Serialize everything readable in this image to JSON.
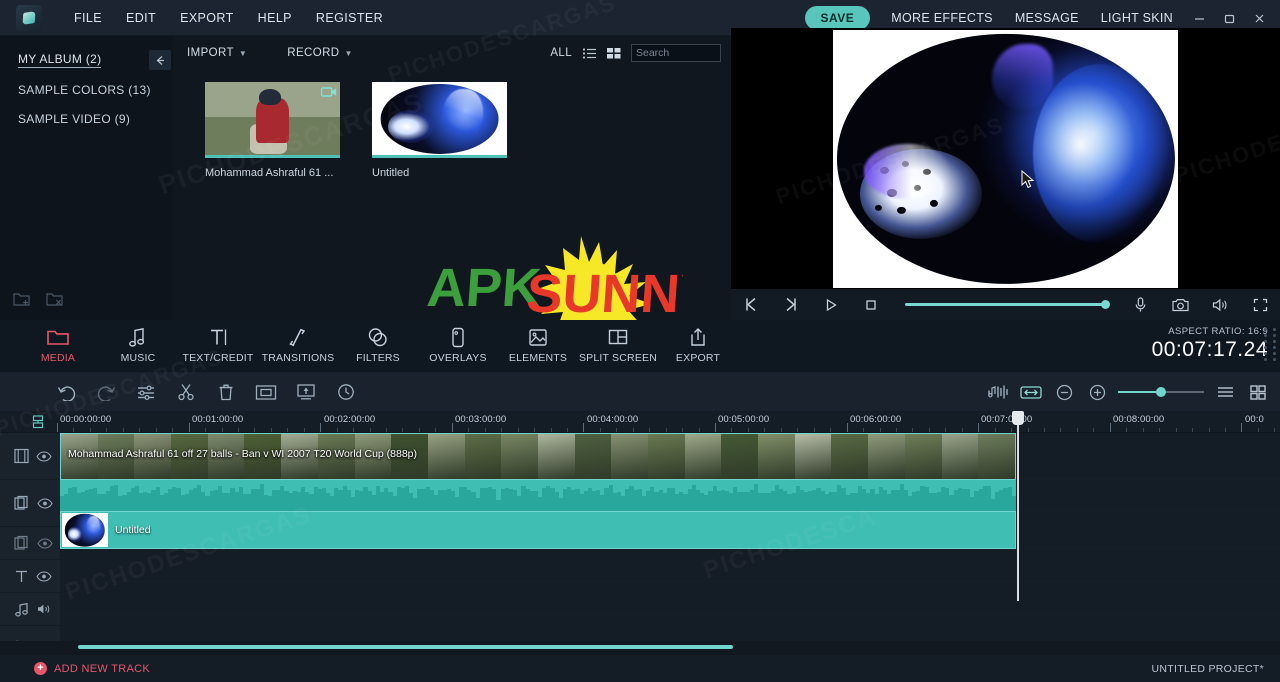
{
  "app": {
    "brand_icon": "filmora-logo-icon",
    "menu": [
      "FILE",
      "EDIT",
      "EXPORT",
      "HELP",
      "REGISTER"
    ],
    "save_label": "SAVE",
    "right_links": [
      "MORE EFFECTS",
      "MESSAGE",
      "LIGHT SKIN"
    ],
    "window_controls": [
      "minimize-icon",
      "restore-icon",
      "close-icon"
    ],
    "accent_teal": "#58c6bb",
    "accent_red": "#e8566a",
    "project_name": "UNTITLED PROJECT*"
  },
  "library": {
    "items": [
      {
        "label": "MY ALBUM (2)",
        "active": true
      },
      {
        "label": "SAMPLE COLORS (13)",
        "active": false
      },
      {
        "label": "SAMPLE VIDEO (9)",
        "active": false
      }
    ],
    "collapse_icon": "arrow-left-icon",
    "bottom_icons": [
      "add-folder-icon",
      "delete-folder-icon"
    ]
  },
  "media_panel": {
    "import_label": "IMPORT",
    "record_label": "RECORD",
    "all_label": "ALL",
    "list_view_icon": "list-view-icon",
    "grid_view_icon": "grid-view-icon",
    "search": {
      "placeholder": "Search",
      "value": "",
      "icon": "search-icon"
    },
    "items": [
      {
        "label": "Mohammad Ashraful 61 ...",
        "type": "video",
        "badge": "video-camera-icon"
      },
      {
        "label": "Untitled",
        "type": "image",
        "badge": ""
      }
    ],
    "watermark_logo": {
      "part1": "APK",
      "part2": "SUNNY"
    }
  },
  "preview": {
    "controls": [
      {
        "name": "prev-frame-button",
        "glyph": "K"
      },
      {
        "name": "next-frame-button",
        "glyph": "K-mirrored"
      },
      {
        "name": "play-button",
        "glyph": "play-triangle"
      },
      {
        "name": "stop-button",
        "glyph": "square"
      }
    ],
    "volume_percent": 100,
    "right_controls": [
      {
        "name": "voiceover-button",
        "glyph": "microphone-icon"
      },
      {
        "name": "snapshot-button",
        "glyph": "camera-icon"
      },
      {
        "name": "volume-button",
        "glyph": "speaker-icon"
      },
      {
        "name": "fullscreen-button",
        "glyph": "expand-icon"
      }
    ]
  },
  "function_tabs": [
    {
      "label": "MEDIA",
      "icon": "folder-icon",
      "active": true
    },
    {
      "label": "MUSIC",
      "icon": "music-note-icon",
      "active": false
    },
    {
      "label": "TEXT/CREDIT",
      "icon": "text-t-icon",
      "active": false
    },
    {
      "label": "TRANSITIONS",
      "icon": "transition-arrows-icon",
      "active": false
    },
    {
      "label": "FILTERS",
      "icon": "filters-circles-icon",
      "active": false
    },
    {
      "label": "OVERLAYS",
      "icon": "overlay-rect-icon",
      "active": false
    },
    {
      "label": "ELEMENTS",
      "icon": "image-elements-icon",
      "active": false
    },
    {
      "label": "SPLIT SCREEN",
      "icon": "split-screen-icon",
      "active": false
    },
    {
      "label": "EXPORT",
      "icon": "export-upload-icon",
      "active": false
    }
  ],
  "project_info": {
    "aspect_label": "ASPECT RATIO:",
    "aspect_value": "16:9",
    "duration": "00:07:17.24"
  },
  "timeline_toolbar": {
    "left_icons": [
      "undo-icon",
      "redo-icon",
      "settings-sliders-icon",
      "scissors-cut-icon",
      "trash-delete-icon",
      "crop-icon",
      "green-screen-icon",
      "speed-clock-icon"
    ],
    "right_icons": [
      "audio-detach-icon",
      "fit-timeline-icon",
      "zoom-out-icon",
      "zoom-in-icon"
    ],
    "zoom_value": 48,
    "view_icons": [
      "list-layout-icon",
      "grid-layout-icon"
    ]
  },
  "ruler": {
    "lock_icon": "timeline-lock-icon",
    "labels": [
      "00:00:00:00",
      "00:01:00:00",
      "00:02:00:00",
      "00:03:00:00",
      "00:04:00:00",
      "00:05:00:00",
      "00:06:00:00",
      "00:07:00:00",
      "00:08:00:00",
      "00:0"
    ],
    "playhead_time": "00:07:00:00"
  },
  "tracks": [
    {
      "name": "video-track-1",
      "icons": [
        "film-strip-icon",
        "eye-icon"
      ]
    },
    {
      "name": "pip-track-1",
      "icons": [
        "layers-icon",
        "eye-icon"
      ]
    },
    {
      "name": "pip-track-2",
      "icons": [
        "layers-icon",
        "eye-icon"
      ]
    },
    {
      "name": "text-track",
      "icons": [
        "text-t-icon",
        "eye-icon"
      ]
    },
    {
      "name": "audio-track",
      "icons": [
        "music-note-icon",
        "speaker-icon"
      ]
    }
  ],
  "clips": {
    "video_clip_title": "Mohammad Ashraful 61 off 27 balls - Ban v WI 2007 T20 World Cup (888p)",
    "pip_clip_title": "Untitled"
  },
  "bottom": {
    "add_track_label": "ADD NEW TRACK",
    "add_track_icon": "plus-circle-icon"
  },
  "watermarks": [
    "PICHODESCARGAS",
    "PICHODESCARGAS",
    "PICHODESCARGAS",
    "PICHODESCARGAS",
    "PICHODESCA"
  ]
}
